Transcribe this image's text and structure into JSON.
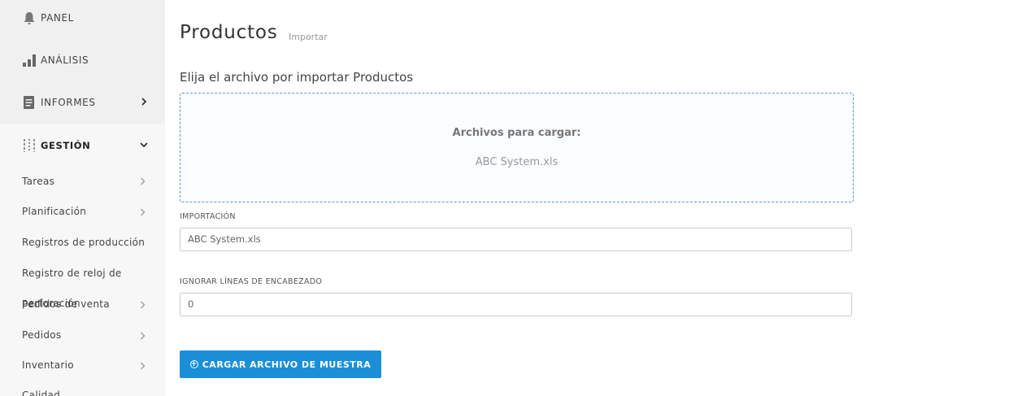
{
  "sidebar": {
    "top_items": [
      {
        "label": "PANEL",
        "icon": "bell-icon"
      },
      {
        "label": "ANÁLISIS",
        "icon": "bar-chart-icon"
      },
      {
        "label": "INFORMES",
        "icon": "document-icon"
      },
      {
        "label": "GESTIÓN",
        "icon": "sliders-icon"
      }
    ],
    "sub_items": [
      {
        "label": "Tareas"
      },
      {
        "label": "Planificación"
      },
      {
        "label": "Registros de producción"
      },
      {
        "label": "Registro de reloj de"
      },
      {
        "label": "perforación"
      },
      {
        "label": "Pedidos de venta"
      },
      {
        "label": "Pedidos"
      },
      {
        "label": "Inventario"
      },
      {
        "label": "Calidad"
      }
    ]
  },
  "page": {
    "title": "Productos",
    "subtitle": "Importar",
    "choose_label": "Elija el archivo por importar Productos"
  },
  "dropzone": {
    "title": "Archivos para cargar:",
    "file": "ABC System.xls"
  },
  "form": {
    "import_label": "IMPORTACIÓN",
    "import_value": "ABC System.xls",
    "ignore_label": "IGNORAR LÍNEAS DE ENCABEZADO",
    "ignore_value": "0"
  },
  "actions": {
    "upload_sample": "CARGAR ARCHIVO DE MUESTRA"
  },
  "colors": {
    "accent": "#1a8fd8",
    "dropzone_border": "#5c96c7"
  }
}
